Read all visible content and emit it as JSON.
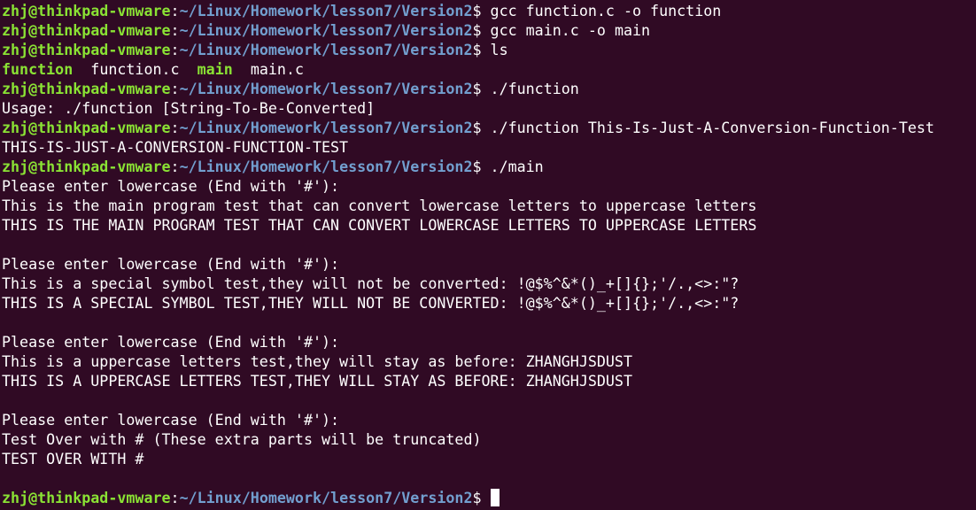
{
  "prompt": {
    "user": "zhj@thinkpad-vmware",
    "sep": ":",
    "path": "~/Linux/Homework/lesson7/Version2",
    "dollar": "$ "
  },
  "lines": [
    {
      "type": "prompt",
      "cmd": "gcc function.c -o function"
    },
    {
      "type": "prompt",
      "cmd": "gcc main.c -o main"
    },
    {
      "type": "prompt",
      "cmd": "ls"
    },
    {
      "type": "ls",
      "items": [
        {
          "name": "function",
          "kind": "exe"
        },
        {
          "name": "function.c",
          "kind": "file"
        },
        {
          "name": "main",
          "kind": "exe"
        },
        {
          "name": "main.c",
          "kind": "file"
        }
      ]
    },
    {
      "type": "prompt",
      "cmd": "./function"
    },
    {
      "type": "output",
      "text": "Usage: ./function [String-To-Be-Converted]"
    },
    {
      "type": "prompt",
      "cmd": "./function This-Is-Just-A-Conversion-Function-Test"
    },
    {
      "type": "output",
      "text": "THIS-IS-JUST-A-CONVERSION-FUNCTION-TEST"
    },
    {
      "type": "prompt",
      "cmd": "./main"
    },
    {
      "type": "output",
      "text": "Please enter lowercase (End with '#'):"
    },
    {
      "type": "output",
      "text": "This is the main program test that can convert lowercase letters to uppercase letters"
    },
    {
      "type": "output",
      "text": "THIS IS THE MAIN PROGRAM TEST THAT CAN CONVERT LOWERCASE LETTERS TO UPPERCASE LETTERS"
    },
    {
      "type": "output",
      "text": ""
    },
    {
      "type": "output",
      "text": "Please enter lowercase (End with '#'):"
    },
    {
      "type": "output",
      "text": "This is a special symbol test,they will not be converted: !@$%^&*()_+[]{};'/.,<>:\"?"
    },
    {
      "type": "output",
      "text": "THIS IS A SPECIAL SYMBOL TEST,THEY WILL NOT BE CONVERTED: !@$%^&*()_+[]{};'/.,<>:\"?"
    },
    {
      "type": "output",
      "text": ""
    },
    {
      "type": "output",
      "text": "Please enter lowercase (End with '#'):"
    },
    {
      "type": "output",
      "text": "This is a uppercase letters test,they will stay as before: ZHANGHJSDUST"
    },
    {
      "type": "output",
      "text": "THIS IS A UPPERCASE LETTERS TEST,THEY WILL STAY AS BEFORE: ZHANGHJSDUST"
    },
    {
      "type": "output",
      "text": ""
    },
    {
      "type": "output",
      "text": "Please enter lowercase (End with '#'):"
    },
    {
      "type": "output",
      "text": "Test Over with # (These extra parts will be truncated)"
    },
    {
      "type": "output",
      "text": "TEST OVER WITH #"
    },
    {
      "type": "output",
      "text": ""
    },
    {
      "type": "prompt",
      "cmd": "",
      "cursor": true
    }
  ],
  "colors": {
    "background": "#300a24",
    "user": "#8ae234",
    "path": "#729fcf",
    "text": "#ffffff",
    "executable": "#8ae234"
  }
}
